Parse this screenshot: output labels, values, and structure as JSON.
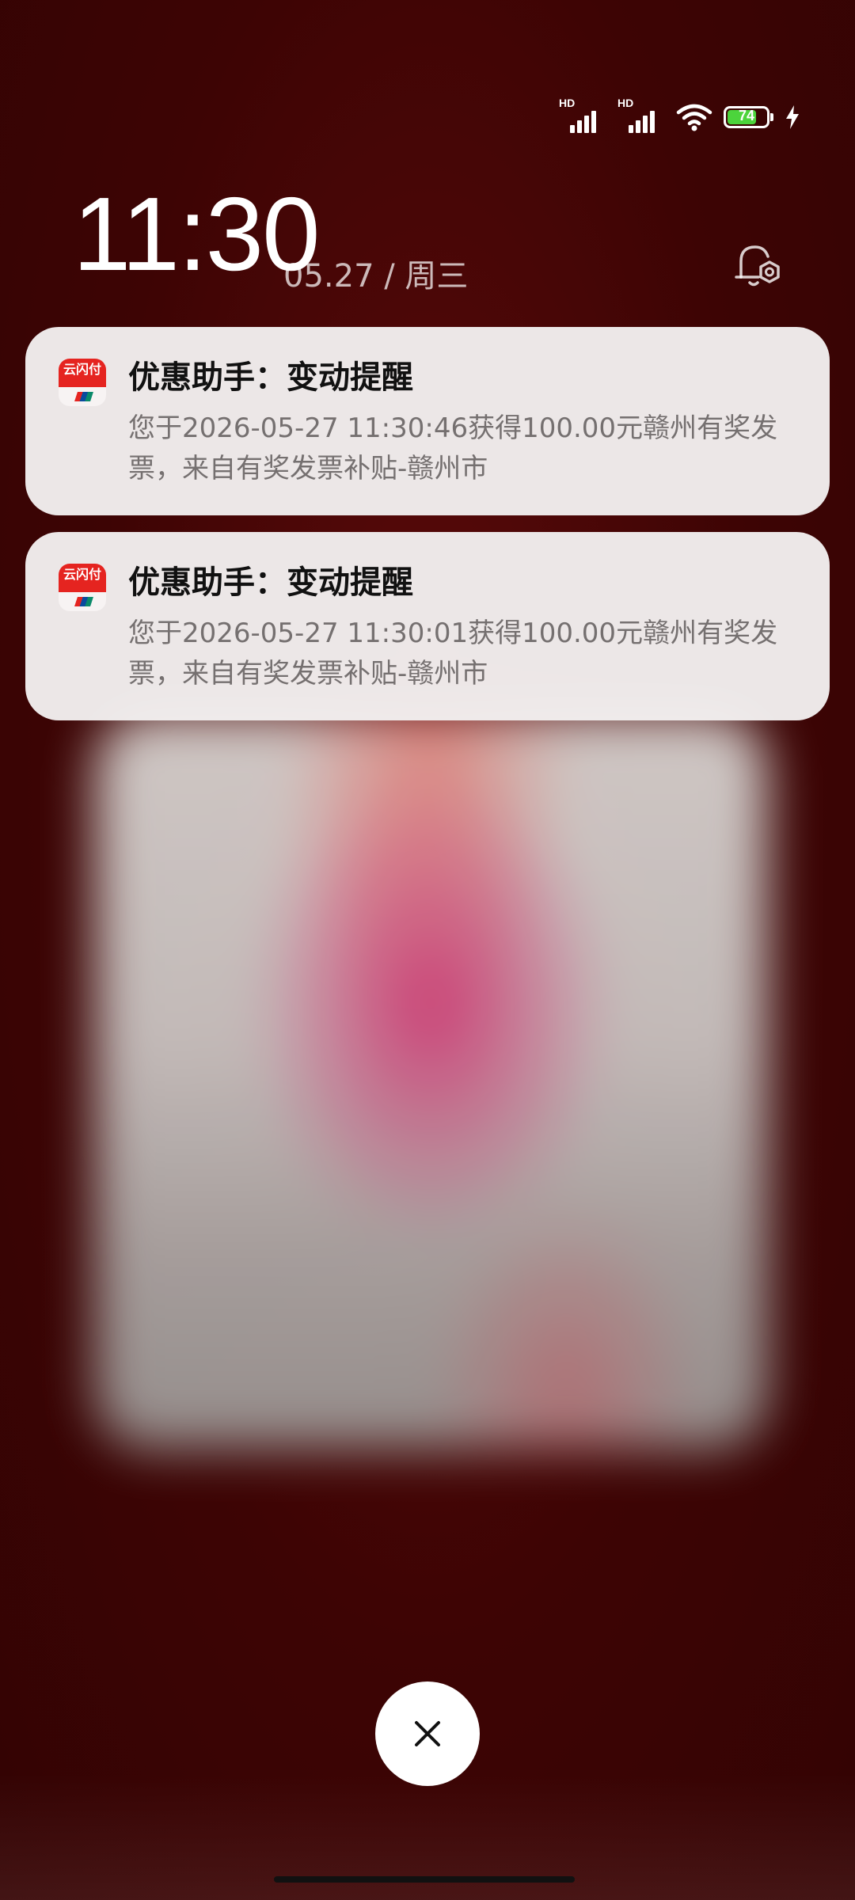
{
  "status_bar": {
    "signal_1_label": "HD",
    "signal_2_label": "HD",
    "battery_level": "74",
    "battery_fraction": 0.74,
    "charging": true
  },
  "lock_screen": {
    "time": "11:30",
    "date": "05.27 / 周三"
  },
  "notifications": [
    {
      "app_icon": "unionpay-app-icon",
      "app_icon_text": "云闪付",
      "title": "优惠助手：变动提醒",
      "body": "您于2026-05-27 11:30:46获得100.00元赣州有奖发票，来自有奖发票补贴-赣州市"
    },
    {
      "app_icon": "unionpay-app-icon",
      "app_icon_text": "云闪付",
      "title": "优惠助手：变动提醒",
      "body": "您于2026-05-27 11:30:01获得100.00元赣州有奖发票，来自有奖发票补贴-赣州市"
    }
  ],
  "controls": {
    "close_icon": "close-icon",
    "notification_settings_icon": "bell-settings-icon"
  },
  "colors": {
    "background": "#3d0404",
    "card": "#f2eeee",
    "accent_red": "#e52420",
    "battery_green": "#4cd43c"
  }
}
